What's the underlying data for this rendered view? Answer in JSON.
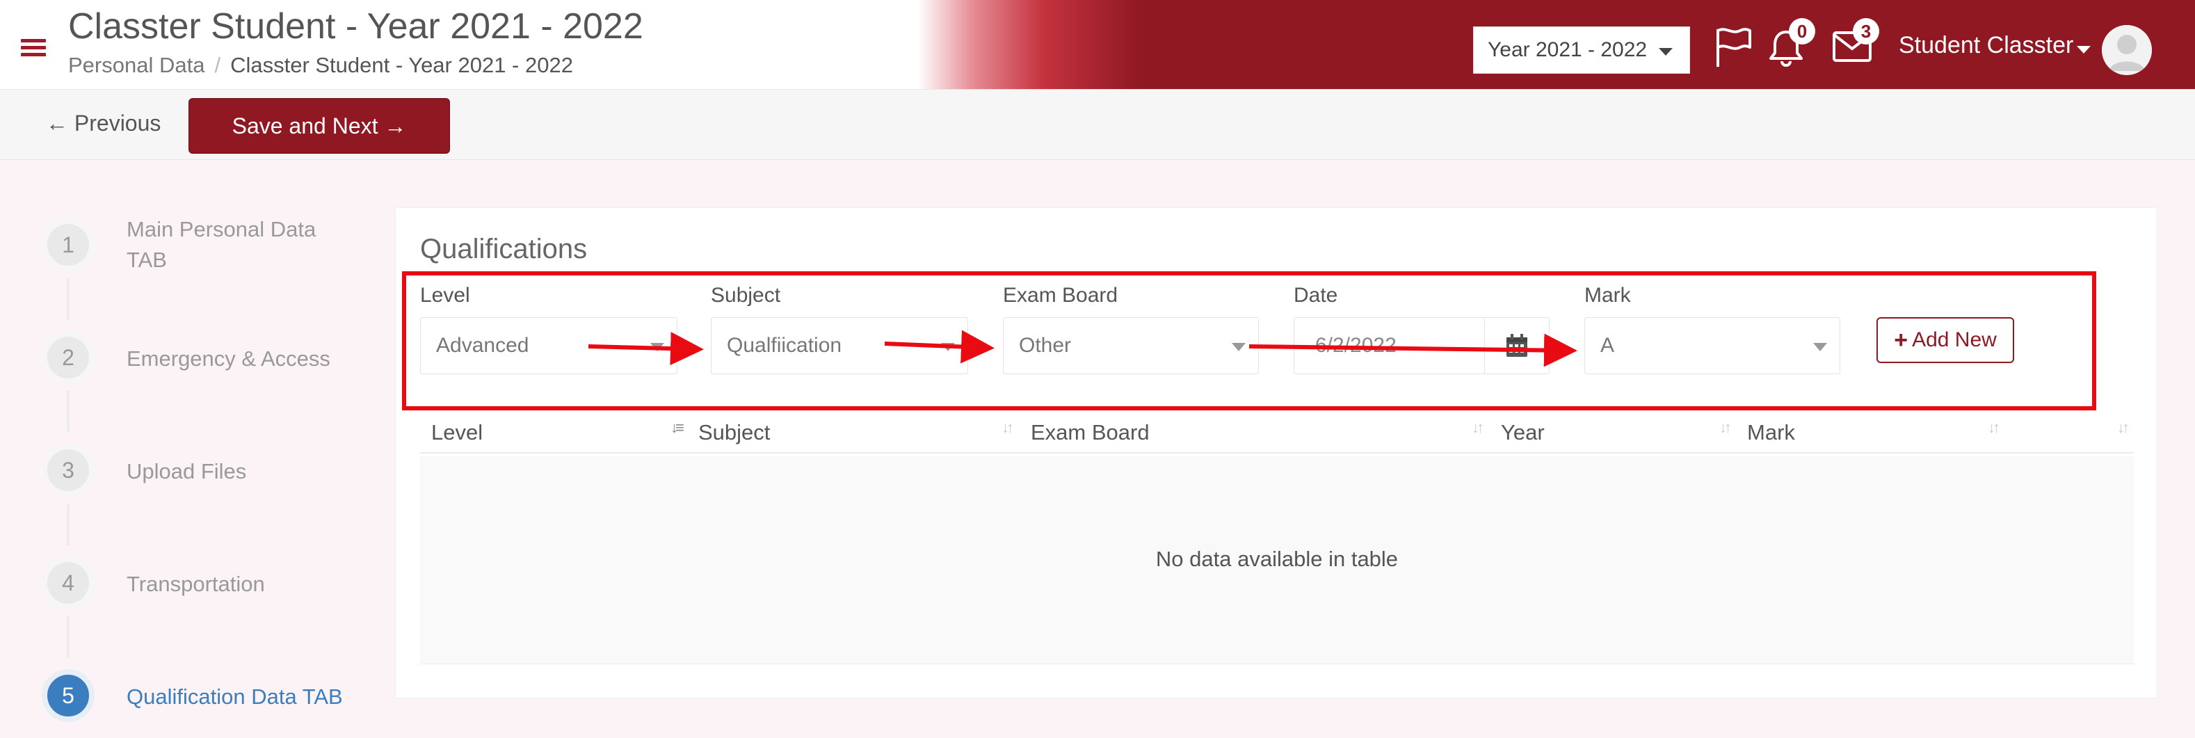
{
  "header": {
    "title": "Classter Student - Year 2021 - 2022",
    "breadcrumb": {
      "root": "Personal Data",
      "current": "Classter Student - Year 2021 - 2022"
    },
    "year_selector": "Year 2021 - 2022",
    "notifications_count": "0",
    "messages_count": "3",
    "user_name": "Student Classter"
  },
  "toolbar": {
    "previous_label": "← Previous",
    "save_next_label": "Save and Next →"
  },
  "steps": [
    {
      "number": "1",
      "label": "Main Personal Data TAB",
      "active": false
    },
    {
      "number": "2",
      "label": "Emergency & Access",
      "active": false
    },
    {
      "number": "3",
      "label": "Upload Files",
      "active": false
    },
    {
      "number": "4",
      "label": "Transportation",
      "active": false
    },
    {
      "number": "5",
      "label": "Qualification Data TAB",
      "active": true
    }
  ],
  "qualifications": {
    "title": "Qualifications",
    "fields": {
      "level": {
        "label": "Level",
        "value": "Advanced"
      },
      "subject": {
        "label": "Subject",
        "value": "Qualfiication"
      },
      "exam_board": {
        "label": "Exam Board",
        "value": "Other"
      },
      "date": {
        "label": "Date",
        "value": "6/2/2022"
      },
      "mark": {
        "label": "Mark",
        "value": "A"
      }
    },
    "add_new_label": "Add New",
    "table": {
      "columns": [
        "Level",
        "Subject",
        "Exam Board",
        "Year",
        "Mark"
      ],
      "empty_message": "No data available in table"
    }
  },
  "colors": {
    "brand": "#8f1823",
    "active_step": "#3a7ebf",
    "annotation": "#ea0a12"
  },
  "icons": [
    "menu-icon",
    "flag-icon",
    "bell-icon",
    "envelope-icon",
    "avatar-icon",
    "calendar-icon",
    "plus-icon",
    "sort-icon"
  ]
}
